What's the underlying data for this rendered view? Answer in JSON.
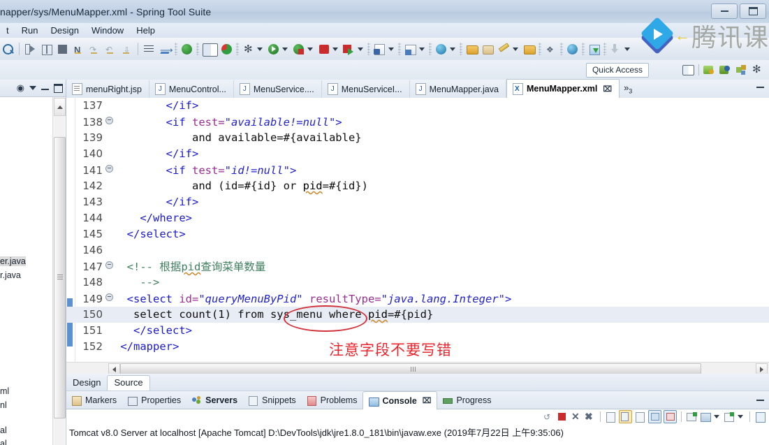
{
  "window": {
    "title": "napper/sys/MenuMapper.xml - Spring Tool Suite",
    "restore_label": "❐",
    "minimize_label": "—"
  },
  "menubar": {
    "items": [
      {
        "label": "t"
      },
      {
        "label": "Run"
      },
      {
        "label": "Design"
      },
      {
        "label": "Window"
      },
      {
        "label": "Help"
      }
    ]
  },
  "quick_access": {
    "label": "Quick Access"
  },
  "watermark": {
    "text": "腾讯课",
    "arrow": "←",
    "brand_color": "#2fa8e8"
  },
  "sidebar": {
    "entries": [
      {
        "label": "er.java",
        "selected": true
      },
      {
        "label": "r.java",
        "selected": false
      },
      {
        "label": "ml",
        "selected": false
      },
      {
        "label": "nl",
        "selected": false
      },
      {
        "label": "al",
        "selected": false
      },
      {
        "label": "al",
        "selected": false
      }
    ]
  },
  "editor": {
    "tabs": [
      {
        "label": "menuRight.jsp",
        "icon": "jsp-file-icon",
        "type": "jsp",
        "active": false
      },
      {
        "label": "MenuControl...",
        "icon": "java-file-icon",
        "type": "java",
        "active": false
      },
      {
        "label": "MenuService....",
        "icon": "java-file-icon",
        "type": "java",
        "active": false
      },
      {
        "label": "MenuServiceI...",
        "icon": "java-file-icon",
        "type": "java",
        "active": false
      },
      {
        "label": "MenuMapper.java",
        "icon": "java-file-icon",
        "type": "java",
        "active": false
      },
      {
        "label": "MenuMapper.xml",
        "icon": "xml-file-icon",
        "type": "xml",
        "active": true,
        "close": "⌧"
      }
    ],
    "more_tabs": "»",
    "more_tabs_count": "3",
    "bottom_tabs": [
      {
        "label": "Design",
        "active": false
      },
      {
        "label": "Source",
        "active": true
      }
    ],
    "lines": [
      {
        "no": "137",
        "fold": false,
        "highlight": false,
        "changed": false,
        "tokens": [
          {
            "t": "        ",
            "c": "ctxt"
          },
          {
            "t": "</if>",
            "c": "c-tag"
          }
        ]
      },
      {
        "no": "138",
        "fold": true,
        "highlight": false,
        "changed": false,
        "tokens": [
          {
            "t": "        ",
            "c": "ctxt"
          },
          {
            "t": "<if ",
            "c": "c-tag"
          },
          {
            "t": "test=",
            "c": "c-attr"
          },
          {
            "t": "\"available!=null\"",
            "c": "c-str"
          },
          {
            "t": ">",
            "c": "c-tag"
          }
        ]
      },
      {
        "no": "139",
        "fold": false,
        "highlight": false,
        "changed": false,
        "tokens": [
          {
            "t": "            and available=#{available}",
            "c": "ctxt"
          }
        ]
      },
      {
        "no": "140",
        "fold": false,
        "highlight": false,
        "changed": false,
        "tokens": [
          {
            "t": "        ",
            "c": "ctxt"
          },
          {
            "t": "</if>",
            "c": "c-tag"
          }
        ]
      },
      {
        "no": "141",
        "fold": true,
        "highlight": false,
        "changed": false,
        "tokens": [
          {
            "t": "        ",
            "c": "ctxt"
          },
          {
            "t": "<if ",
            "c": "c-tag"
          },
          {
            "t": "test=",
            "c": "c-attr"
          },
          {
            "t": "\"id!=null\"",
            "c": "c-str"
          },
          {
            "t": ">",
            "c": "c-tag"
          }
        ]
      },
      {
        "no": "142",
        "fold": false,
        "highlight": false,
        "changed": false,
        "tokens": [
          {
            "t": "            and (id=#{id} or ",
            "c": "ctxt"
          },
          {
            "t": "pid",
            "c": "sq-underline"
          },
          {
            "t": "=#{id})",
            "c": "ctxt"
          }
        ]
      },
      {
        "no": "143",
        "fold": false,
        "highlight": false,
        "changed": false,
        "tokens": [
          {
            "t": "        ",
            "c": "ctxt"
          },
          {
            "t": "</if>",
            "c": "c-tag"
          }
        ]
      },
      {
        "no": "144",
        "fold": false,
        "highlight": false,
        "changed": false,
        "tokens": [
          {
            "t": "    ",
            "c": "ctxt"
          },
          {
            "t": "</where>",
            "c": "c-tag"
          }
        ]
      },
      {
        "no": "145",
        "fold": false,
        "highlight": false,
        "changed": false,
        "tokens": [
          {
            "t": "  ",
            "c": "ctxt"
          },
          {
            "t": "</select>",
            "c": "c-tag"
          }
        ]
      },
      {
        "no": "146",
        "fold": false,
        "highlight": false,
        "changed": false,
        "tokens": [
          {
            "t": "",
            "c": "ctxt"
          }
        ]
      },
      {
        "no": "147",
        "fold": true,
        "highlight": false,
        "changed": false,
        "tokens": [
          {
            "t": "  ",
            "c": "ctxt"
          },
          {
            "t": "<!-- 根据",
            "c": "c-cmt"
          },
          {
            "t": "pid",
            "c": "c-cmt sq-underline"
          },
          {
            "t": "查询菜单数量",
            "c": "c-cmt"
          }
        ]
      },
      {
        "no": "148",
        "fold": false,
        "highlight": false,
        "changed": false,
        "tokens": [
          {
            "t": "    ",
            "c": "ctxt"
          },
          {
            "t": "-->",
            "c": "c-cmt"
          }
        ]
      },
      {
        "no": "149",
        "fold": true,
        "highlight": false,
        "changed": true,
        "tokens": [
          {
            "t": "  ",
            "c": "ctxt"
          },
          {
            "t": "<select ",
            "c": "c-tag"
          },
          {
            "t": "id=",
            "c": "c-attr"
          },
          {
            "t": "\"queryMenuByPid\"",
            "c": "c-str"
          },
          {
            "t": " ",
            "c": "ctxt"
          },
          {
            "t": "resultType=",
            "c": "c-attr"
          },
          {
            "t": "\"java.lang.Integer\"",
            "c": "c-str"
          },
          {
            "t": ">",
            "c": "c-tag"
          }
        ]
      },
      {
        "no": "150",
        "fold": false,
        "highlight": true,
        "changed": true,
        "tokens": [
          {
            "t": "   select count(1) from sys_menu where ",
            "c": "ctxt"
          },
          {
            "t": "pid",
            "c": "sq-underline"
          },
          {
            "t": "=#{pid}",
            "c": "ctxt"
          }
        ]
      },
      {
        "no": "151",
        "fold": false,
        "highlight": false,
        "changed": true,
        "tokens": [
          {
            "t": "   ",
            "c": "ctxt"
          },
          {
            "t": "</select>",
            "c": "c-tag"
          }
        ]
      },
      {
        "no": "152",
        "fold": false,
        "highlight": false,
        "changed": false,
        "tokens": [
          {
            "t": " ",
            "c": "ctxt"
          },
          {
            "t": "</mapper>",
            "c": "c-tag"
          }
        ]
      }
    ],
    "annotations": {
      "ellipse_target": "sys_menu",
      "note_text": "注意字段不要写错",
      "note_color": "#e8242c"
    }
  },
  "bottom_panel": {
    "tabs": [
      {
        "label": "Markers",
        "icon": "markers-icon",
        "active": false,
        "bold": false
      },
      {
        "label": "Properties",
        "icon": "properties-icon",
        "active": false,
        "bold": false
      },
      {
        "label": "Servers",
        "icon": "servers-icon",
        "active": false,
        "bold": true
      },
      {
        "label": "Snippets",
        "icon": "snippets-icon",
        "active": false,
        "bold": false
      },
      {
        "label": "Problems",
        "icon": "problems-icon",
        "active": false,
        "bold": false
      },
      {
        "label": "Console",
        "icon": "console-icon",
        "active": true,
        "bold": true,
        "close": "⌧"
      },
      {
        "label": "Progress",
        "icon": "progress-icon",
        "active": false,
        "bold": false
      }
    ],
    "console_line": "Tomcat v8.0 Server at localhost [Apache Tomcat] D:\\DevTools\\jdk\\jre1.8.0_181\\bin\\javaw.exe (2019年7月22日 上午9:35:06)"
  }
}
